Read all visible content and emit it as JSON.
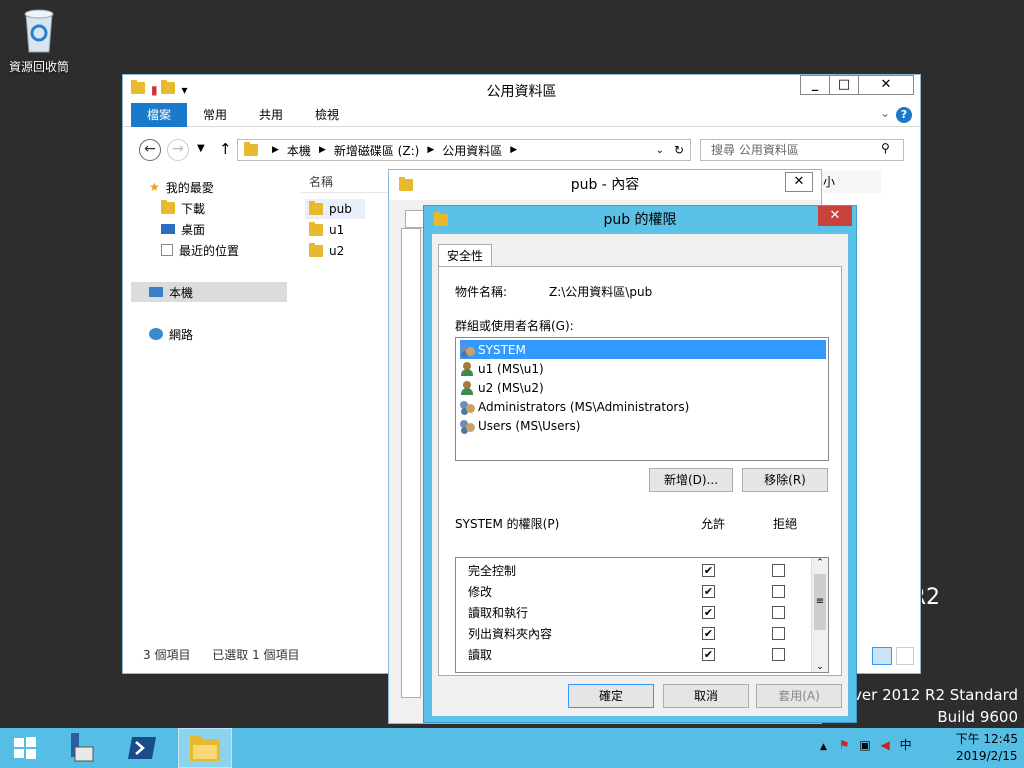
{
  "desktop": {
    "recycle_bin": "資源回收筒",
    "watermark_line1": "rver 2012 R2 Standard",
    "watermark_line2": "Build 9600",
    "watermark_r2": "R2"
  },
  "explorer": {
    "title": "公用資料區",
    "tabs": [
      "檔案",
      "常用",
      "共用",
      "檢視"
    ],
    "breadcrumb": [
      "本機",
      "新增磁碟區 (Z:)",
      "公用資料區"
    ],
    "search_placeholder": "搜尋 公用資料區",
    "nav": {
      "favorites": "我的最愛",
      "downloads": "下載",
      "desktop": "桌面",
      "recent": "最近的位置",
      "this_pc": "本機",
      "network": "網路"
    },
    "column_name": "名稱",
    "column_size_partial": "小",
    "files": [
      "pub",
      "u1",
      "u2"
    ],
    "status_count": "3 個項目",
    "status_selected": "已選取 1 個項目"
  },
  "props": {
    "title": "pub - 內容"
  },
  "perm": {
    "title": "pub 的權限",
    "tab": "安全性",
    "object_label": "物件名稱:",
    "object_value": "Z:\\公用資料區\\pub",
    "group_label": "群組或使用者名稱(G):",
    "principals": [
      {
        "name": "SYSTEM",
        "type": "group"
      },
      {
        "name": "u1 (MS\\u1)",
        "type": "user"
      },
      {
        "name": "u2 (MS\\u2)",
        "type": "user"
      },
      {
        "name": "Administrators (MS\\Administrators)",
        "type": "group"
      },
      {
        "name": "Users (MS\\Users)",
        "type": "group"
      }
    ],
    "add_button": "新增(D)...",
    "remove_button": "移除(R)",
    "perm_label": "SYSTEM 的權限(P)",
    "allow_header": "允許",
    "deny_header": "拒絕",
    "permissions": [
      {
        "name": "完全控制",
        "allow": true,
        "deny": false
      },
      {
        "name": "修改",
        "allow": true,
        "deny": false
      },
      {
        "name": "讀取和執行",
        "allow": true,
        "deny": false
      },
      {
        "name": "列出資料夾內容",
        "allow": true,
        "deny": false
      },
      {
        "name": "讀取",
        "allow": true,
        "deny": false
      }
    ],
    "ok": "確定",
    "cancel": "取消",
    "apply": "套用(A)"
  },
  "taskbar": {
    "time": "下午 12:45",
    "date": "2019/2/15",
    "ime": "中"
  }
}
